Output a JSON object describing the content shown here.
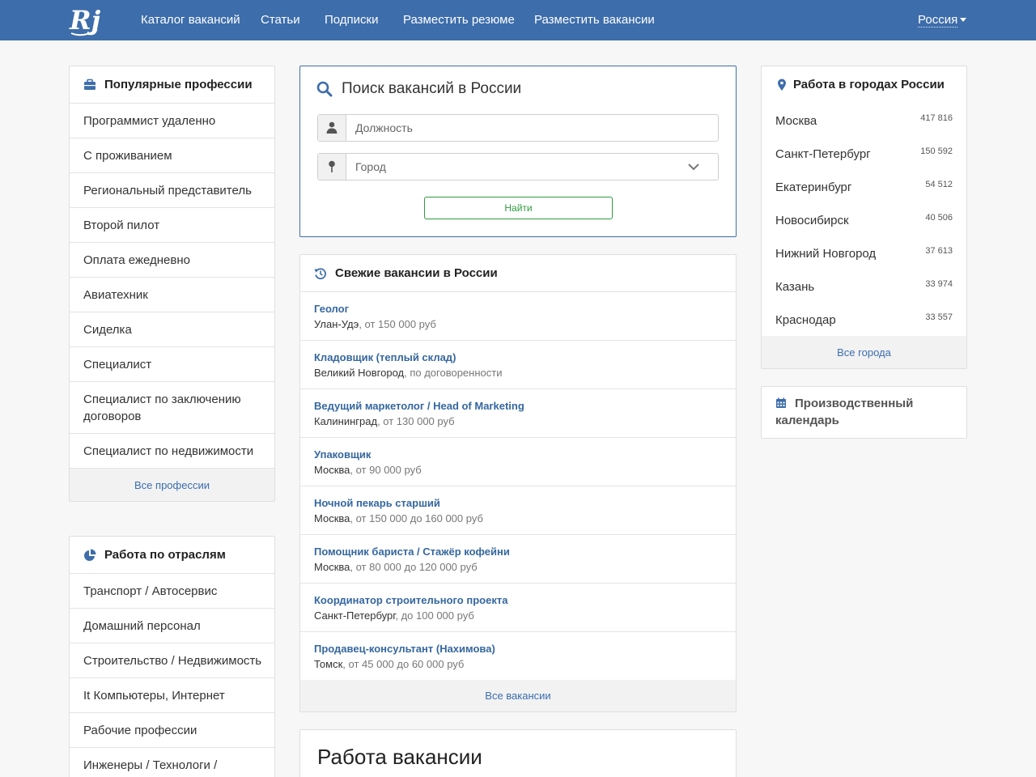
{
  "nav": {
    "logo_text": "Rj",
    "links": [
      "Каталог вакансий",
      "Статьи",
      "Подписки",
      "Разместить резюме",
      "Разместить вакансии"
    ],
    "region": "Россия"
  },
  "popular": {
    "title": "Популярные профессии",
    "items": [
      "Программист удаленно",
      "С проживанием",
      "Региональный представитель",
      "Второй пилот",
      "Оплата ежедневно",
      "Авиатехник",
      "Сиделка",
      "Специалист",
      "Специалист по заключению договоров",
      "Специалист по недвижимости"
    ],
    "footer": "Все профессии"
  },
  "industries": {
    "title": "Работа по отраслям",
    "items": [
      "Транспорт / Автосервис",
      "Домашний персонал",
      "Строительство / Недвижимость",
      "It Компьютеры, Интернет",
      "Рабочие профессии",
      "Инженеры / Технологи /"
    ]
  },
  "search": {
    "title": "Поиск вакансий в России",
    "position_placeholder": "Должность",
    "city_placeholder": "Город",
    "button": "Найти"
  },
  "fresh": {
    "title": "Свежие вакансии в России",
    "items": [
      {
        "title": "Геолог",
        "city": "Улан-Удэ",
        "salary": ", от 150 000 руб"
      },
      {
        "title": "Кладовщик (теплый склад)",
        "city": "Великий Новгород",
        "salary": ", по договоренности"
      },
      {
        "title": "Ведущий маркетолог / Head of Marketing",
        "city": "Калининград",
        "salary": ", от 130 000 руб"
      },
      {
        "title": "Упаковщик",
        "city": "Москва",
        "salary": ", от 90 000 руб"
      },
      {
        "title": "Ночной пекарь старший",
        "city": "Москва",
        "salary": ", от 150 000 до 160 000 руб"
      },
      {
        "title": "Помощник бариста / Стажёр кофейни",
        "city": "Москва",
        "salary": ", от 80 000 до 120 000 руб"
      },
      {
        "title": "Координатор строительного проекта",
        "city": "Санкт-Петербург",
        "salary": ", до 100 000 руб"
      },
      {
        "title": "Продавец-консультант (Нахимова)",
        "city": "Томск",
        "salary": ", от 45 000 до 60 000 руб"
      }
    ],
    "footer": "Все вакансии"
  },
  "work": {
    "title": "Работа вакансии"
  },
  "cities": {
    "title": "Работа в городах России",
    "items": [
      {
        "name": "Москва",
        "count": "417 816"
      },
      {
        "name": "Санкт-Петербург",
        "count": "150 592"
      },
      {
        "name": "Екатеринбург",
        "count": "54 512"
      },
      {
        "name": "Новосибирск",
        "count": "40 506"
      },
      {
        "name": "Нижний Новгород",
        "count": "37 613"
      },
      {
        "name": "Казань",
        "count": "33 974"
      },
      {
        "name": "Краснодар",
        "count": "33 557"
      }
    ],
    "footer": "Все города"
  },
  "calendar": {
    "line1": "Производственный",
    "line2": "календарь"
  },
  "colors": {
    "navbar": "#3d6daa",
    "link": "#35679f",
    "button": "#2e9b3e"
  }
}
